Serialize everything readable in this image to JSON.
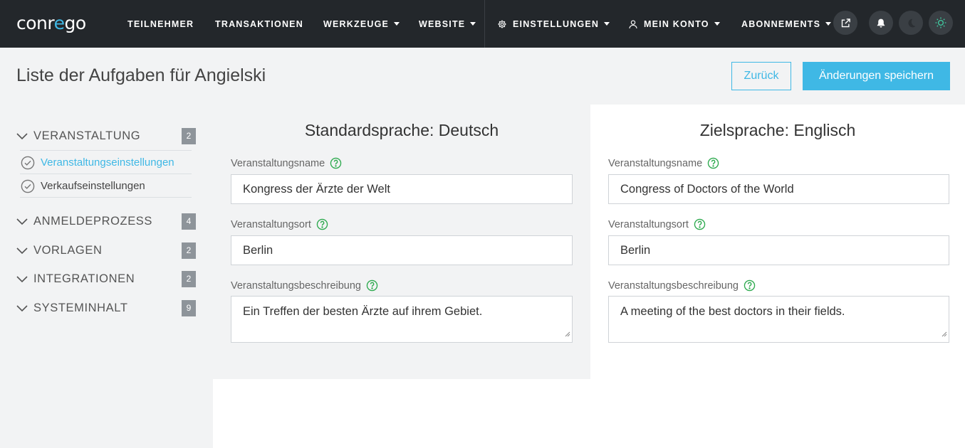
{
  "brand": {
    "logo_text": "conrego"
  },
  "nav": {
    "items": [
      {
        "label": "TEILNEHMER"
      },
      {
        "label": "TRANSAKTIONEN"
      },
      {
        "label": "WERKZEUGE"
      },
      {
        "label": "WEBSITE"
      },
      {
        "label": "EINSTELLUNGEN"
      },
      {
        "label": "MEIN KONTO"
      },
      {
        "label": "ABONNEMENTS"
      }
    ],
    "icons": [
      "external-link-icon",
      "bell-icon",
      "moon-icon",
      "sun-icon"
    ]
  },
  "header": {
    "title": "Liste der Aufgaben für Angielski",
    "back_label": "Zurück",
    "save_label": "Änderungen speichern"
  },
  "sidebar": {
    "sections": [
      {
        "label": "VERANSTALTUNG",
        "count": "2",
        "items": [
          {
            "label": "Veranstaltungseinstellungen",
            "active": true
          },
          {
            "label": "Verkaufseinstellungen",
            "active": false
          }
        ]
      },
      {
        "label": "ANMELDEPROZESS",
        "count": "4"
      },
      {
        "label": "VORLAGEN",
        "count": "2"
      },
      {
        "label": "INTEGRATIONEN",
        "count": "2"
      },
      {
        "label": "SYSTEMINHALT",
        "count": "9"
      }
    ]
  },
  "source": {
    "heading": "Standardsprache: Deutsch",
    "fields": [
      {
        "label": "Veranstaltungsname",
        "value": "Kongress der Ärzte der Welt"
      },
      {
        "label": "Veranstaltungsort",
        "value": "Berlin"
      },
      {
        "label": "Veranstaltungsbeschreibung",
        "value": "Ein Treffen der besten Ärzte auf ihrem Gebiet."
      }
    ]
  },
  "target": {
    "heading": "Zielsprache: Englisch",
    "fields": [
      {
        "label": "Veranstaltungsname",
        "value": "Congress of Doctors of the World"
      },
      {
        "label": "Veranstaltungsort",
        "value": "Berlin"
      },
      {
        "label": "Veranstaltungsbeschreibung",
        "value": "A meeting of the best doctors in their fields."
      }
    ]
  },
  "colors": {
    "accent": "#3fb8e5",
    "navbar": "#23272b",
    "help": "#2eaa4f",
    "badge": "#8e949a"
  }
}
